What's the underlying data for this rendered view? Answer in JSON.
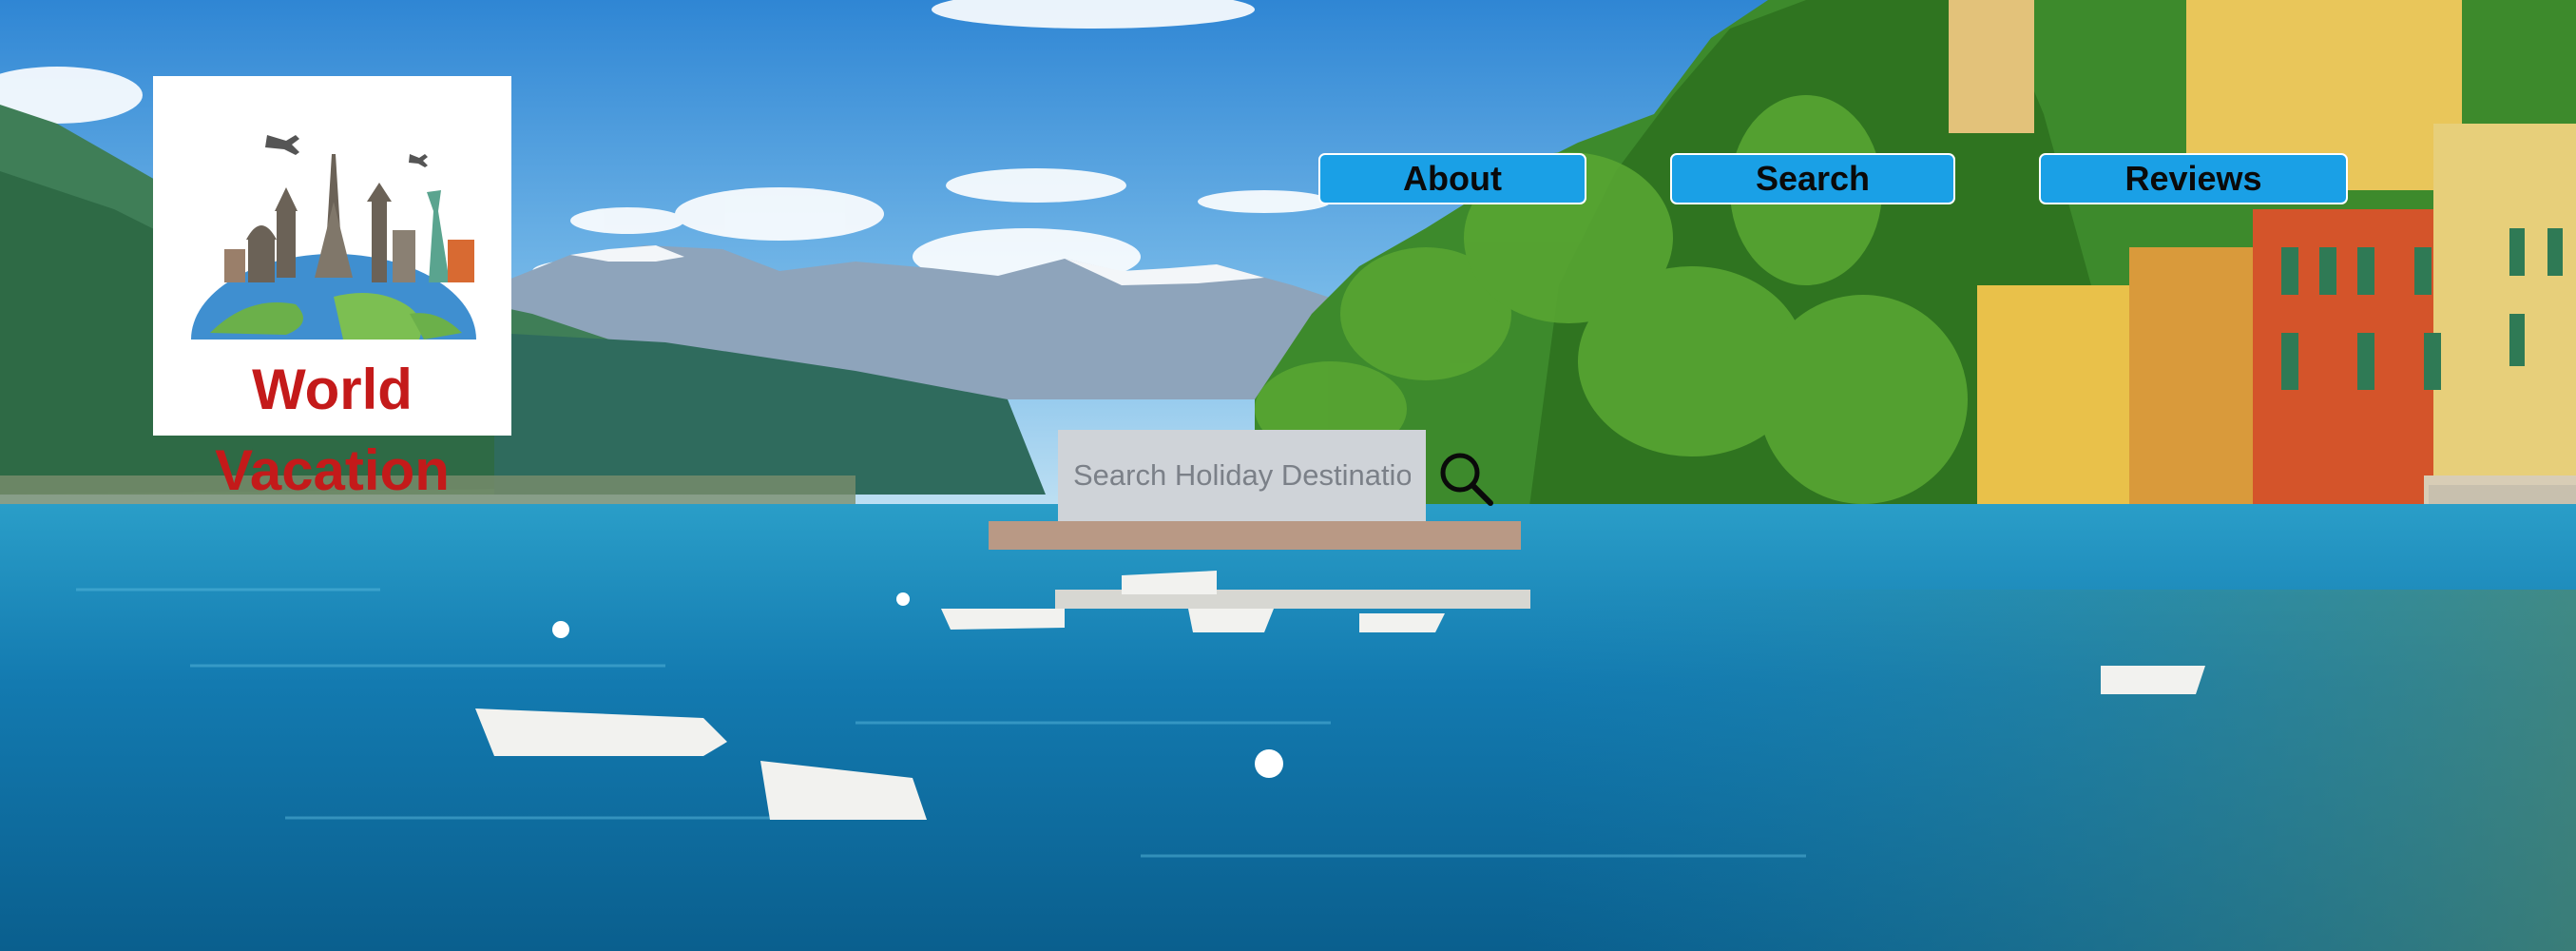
{
  "logo": {
    "line1": "World",
    "line2": "Vacation",
    "icon": "world-landmarks-globe-icon",
    "text_color": "#c41a1a"
  },
  "nav": {
    "items": [
      {
        "label": "About"
      },
      {
        "label": "Search"
      },
      {
        "label": "Reviews"
      }
    ],
    "button_color": "#1aa0e6"
  },
  "search": {
    "value": "",
    "placeholder": "Search Holiday Destinations",
    "icon": "magnifier-icon"
  },
  "background": {
    "scene": "lake-village-photo"
  }
}
